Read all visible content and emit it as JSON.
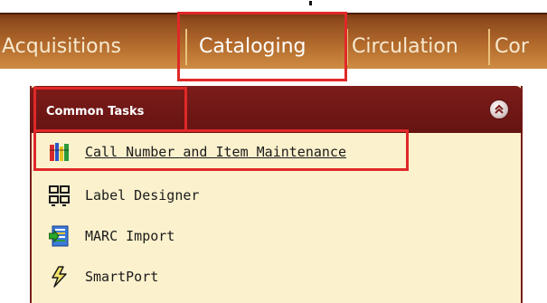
{
  "nav": {
    "tabs": [
      {
        "label": "Acquisitions"
      },
      {
        "label": "Cataloging"
      },
      {
        "label": "Circulation"
      },
      {
        "label": "Cor"
      }
    ]
  },
  "panel": {
    "title": "Common Tasks",
    "tasks": [
      {
        "label": "Call Number and Item Maintenance",
        "icon": "books-icon"
      },
      {
        "label": "Label Designer",
        "icon": "label-grid-icon"
      },
      {
        "label": "MARC Import",
        "icon": "import-icon"
      },
      {
        "label": "SmartPort",
        "icon": "lightning-icon"
      }
    ]
  },
  "colors": {
    "nav_bar": "#a85f27",
    "panel_header": "#731a18",
    "panel_body": "#fbf1cd",
    "highlight": "#e02828"
  }
}
